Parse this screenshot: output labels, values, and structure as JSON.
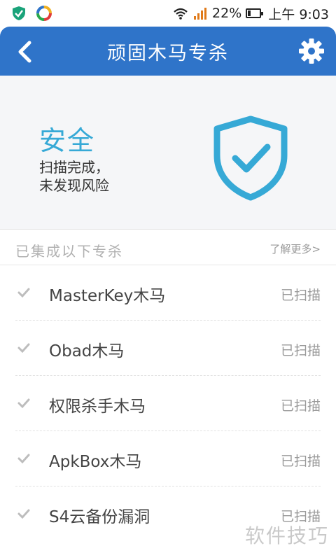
{
  "statusbar": {
    "battery": "22%",
    "time": "上午 9:03",
    "icons": [
      "shield-app-icon",
      "colorful-app-icon",
      "wifi-icon",
      "signal-icon",
      "battery-icon"
    ]
  },
  "appbar": {
    "title": "顽固木马专杀",
    "back_icon": "chevron-left-icon",
    "settings_icon": "gear-icon"
  },
  "hero": {
    "status": "安全",
    "desc_line1": "扫描完成，",
    "desc_line2": "未发现风险",
    "icon": "shield-check-icon"
  },
  "section": {
    "title": "已集成以下专杀",
    "learn_more": "了解更多>"
  },
  "items": [
    {
      "name": "MasterKey木马",
      "status": "已扫描"
    },
    {
      "name": "Obad木马",
      "status": "已扫描"
    },
    {
      "name": "权限杀手木马",
      "status": "已扫描"
    },
    {
      "name": "ApkBox木马",
      "status": "已扫描"
    },
    {
      "name": "S4云备份漏洞",
      "status": "已扫描"
    }
  ],
  "watermark": "软件技巧",
  "colors": {
    "appbar": "#2f74c9",
    "accent": "#36a9d6",
    "check": "#bdbdbd"
  }
}
